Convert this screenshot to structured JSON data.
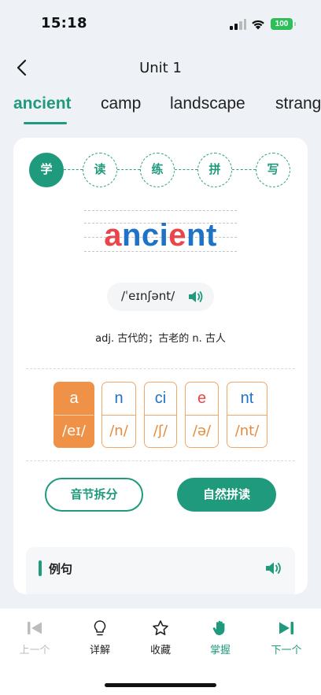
{
  "status_bar": {
    "time": "15:18",
    "battery": "100"
  },
  "nav": {
    "title": "Unit 1",
    "back_icon": "chevron-left-icon"
  },
  "tabs": [
    {
      "label": "ancient",
      "active": true
    },
    {
      "label": "camp",
      "active": false
    },
    {
      "label": "landscape",
      "active": false
    },
    {
      "label": "strange",
      "active": false
    }
  ],
  "steps": [
    {
      "label": "学",
      "active": true
    },
    {
      "label": "读",
      "active": false
    },
    {
      "label": "练",
      "active": false
    },
    {
      "label": "拼",
      "active": false
    },
    {
      "label": "写",
      "active": false
    }
  ],
  "word": {
    "parts": [
      {
        "text": "a",
        "color": "#e8464a"
      },
      {
        "text": "nci",
        "color": "#1e73c8"
      },
      {
        "text": "e",
        "color": "#e8464a"
      },
      {
        "text": "nt",
        "color": "#1e73c8"
      }
    ],
    "phonetic": "/ˈeɪnʃənt/",
    "meaning": "adj. 古代的；古老的 n. 古人"
  },
  "syllables": [
    {
      "letters": "a",
      "sound": "/eɪ/",
      "active": true,
      "color": "#ffffff"
    },
    {
      "letters": "n",
      "sound": "/n/",
      "active": false,
      "color": "#1e73c8"
    },
    {
      "letters": "ci",
      "sound": "/ʃ/",
      "active": false,
      "color": "#1e73c8"
    },
    {
      "letters": "e",
      "sound": "/ə/",
      "active": false,
      "color": "#e8464a"
    },
    {
      "letters": "nt",
      "sound": "/nt/",
      "active": false,
      "color": "#1e73c8"
    }
  ],
  "actions": {
    "syllable_split": "音节拆分",
    "natural_phonics": "自然拼读"
  },
  "example": {
    "title": "例句",
    "speaker_icon": "speaker-icon"
  },
  "toolbar": [
    {
      "label": "上一个",
      "icon": "previous-icon",
      "state": "disabled"
    },
    {
      "label": "详解",
      "icon": "lightbulb-icon",
      "state": "normal"
    },
    {
      "label": "收藏",
      "icon": "star-icon",
      "state": "normal"
    },
    {
      "label": "掌握",
      "icon": "hand-icon",
      "state": "green"
    },
    {
      "label": "下一个",
      "icon": "next-icon",
      "state": "green"
    }
  ],
  "colors": {
    "accent": "#1f9a7c",
    "orange": "#ef9248",
    "red": "#e8464a",
    "blue": "#1e73c8"
  }
}
